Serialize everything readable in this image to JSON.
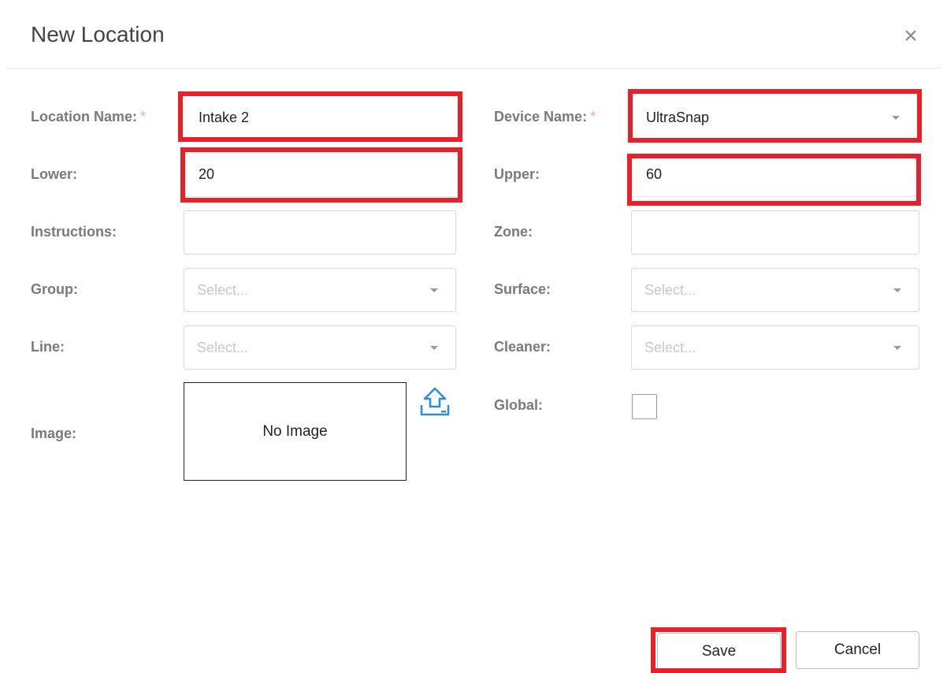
{
  "dialog": {
    "title": "New Location",
    "close_symbol": "×"
  },
  "form": {
    "location_name": {
      "label": "Location Name:",
      "required_mark": "*",
      "value": "Intake 2"
    },
    "device_name": {
      "label": "Device Name:",
      "required_mark": "*",
      "value": "UltraSnap"
    },
    "lower": {
      "label": "Lower:",
      "value": "20"
    },
    "upper": {
      "label": "Upper:",
      "value": "60"
    },
    "instructions": {
      "label": "Instructions:",
      "value": ""
    },
    "zone": {
      "label": "Zone:",
      "value": ""
    },
    "group": {
      "label": "Group:",
      "placeholder": "Select..."
    },
    "surface": {
      "label": "Surface:",
      "placeholder": "Select..."
    },
    "line": {
      "label": "Line:",
      "placeholder": "Select..."
    },
    "cleaner": {
      "label": "Cleaner:",
      "placeholder": "Select..."
    },
    "image": {
      "label": "Image:",
      "empty_text": "No Image",
      "upload_icon": "upload-icon"
    },
    "global": {
      "label": "Global:",
      "checked": false
    }
  },
  "footer": {
    "save_label": "Save",
    "cancel_label": "Cancel"
  },
  "colors": {
    "highlight": "#e8202a",
    "upload_icon": "#2a8fd6",
    "required": "#f4a6a6"
  }
}
